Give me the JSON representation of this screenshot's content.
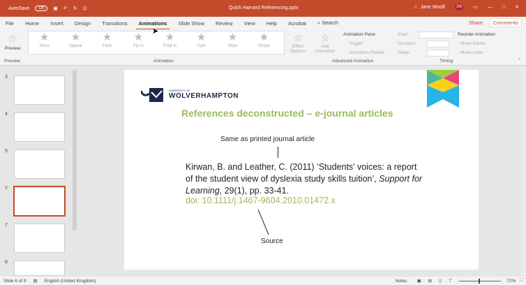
{
  "titlebar": {
    "autosave": "AutoSave",
    "autosave_state": "Off",
    "title": "Quick Harvard Referencing.pptx",
    "user": "Jane Woolf",
    "initials": "JW"
  },
  "tabs": [
    "File",
    "Home",
    "Insert",
    "Design",
    "Transitions",
    "Animations",
    "Slide Show",
    "Review",
    "View",
    "Help",
    "Acrobat"
  ],
  "search": "Search",
  "share": "Share",
  "comments": "Comments",
  "ribbon": {
    "preview": "Preview",
    "preview_group": "Preview",
    "effects": [
      "None",
      "Appear",
      "Fade",
      "Fly In",
      "Float In",
      "Split",
      "Wipe",
      "Shape"
    ],
    "effect_options": "Effect Options",
    "animation_group": "Animation",
    "add_animation": "Add Animation",
    "animation_pane": "Animation Pane",
    "trigger": "Trigger",
    "animation_painter": "Animation Painter",
    "advanced_group": "Advanced Animation",
    "start": "Start:",
    "duration": "Duration:",
    "delay": "Delay:",
    "timing_group": "Timing",
    "reorder": "Reorder Animation",
    "move_earlier": "Move Earlier",
    "move_later": "Move Later"
  },
  "thumbnails": [
    {
      "n": "3"
    },
    {
      "n": "4"
    },
    {
      "n": "5"
    },
    {
      "n": "6",
      "selected": true
    },
    {
      "n": "7"
    },
    {
      "n": "8"
    }
  ],
  "slide": {
    "logo_small": "UNIVERSITY OF",
    "logo_big": "WOLVERHAMPTON",
    "heading": "References deconstructed – e-journal articles",
    "label_top": "Same as printed journal article",
    "ref_plain": "Kirwan, B. and Leather, C. (2011) ‘Students’ voices: a report of the student view of dyslexia study skills tuition’, ",
    "ref_italic": "Support for Learning",
    "ref_end": ", 29(1), pp. 33-41.",
    "doi": "doi: 10.1111/j.1467-9604.2010.01472.x",
    "label_bottom": "Source"
  },
  "status": {
    "slide": "Slide 6 of 9",
    "language": "English (United Kingdom)",
    "notes": "Notes",
    "zoom": "72%"
  }
}
